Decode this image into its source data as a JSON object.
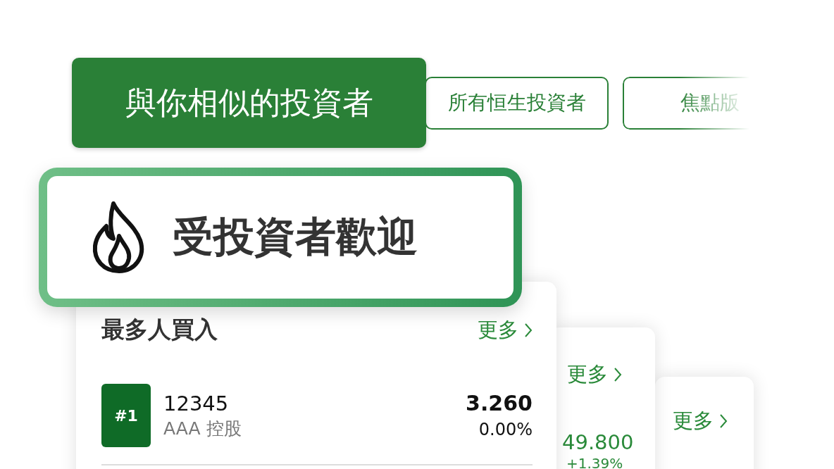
{
  "tabs": [
    {
      "label": "與你相似的投資者",
      "selected": true
    },
    {
      "label": "所有恒生投資者",
      "selected": false
    },
    {
      "label": "焦點版",
      "selected": false
    }
  ],
  "banner": {
    "title": "受投資者歡迎"
  },
  "cards": [
    {
      "title": "最多人買入",
      "more": "更多",
      "rows": [
        {
          "rank": "#1",
          "code": "12345",
          "name": "AAA 控股",
          "price": "3.260",
          "change": "0.00%",
          "kind": "flat"
        }
      ]
    },
    {
      "more": "更多",
      "rows": [
        {
          "price": "49.800",
          "change": "+1.39%",
          "kind": "up"
        }
      ]
    },
    {
      "more": "更多"
    }
  ]
}
